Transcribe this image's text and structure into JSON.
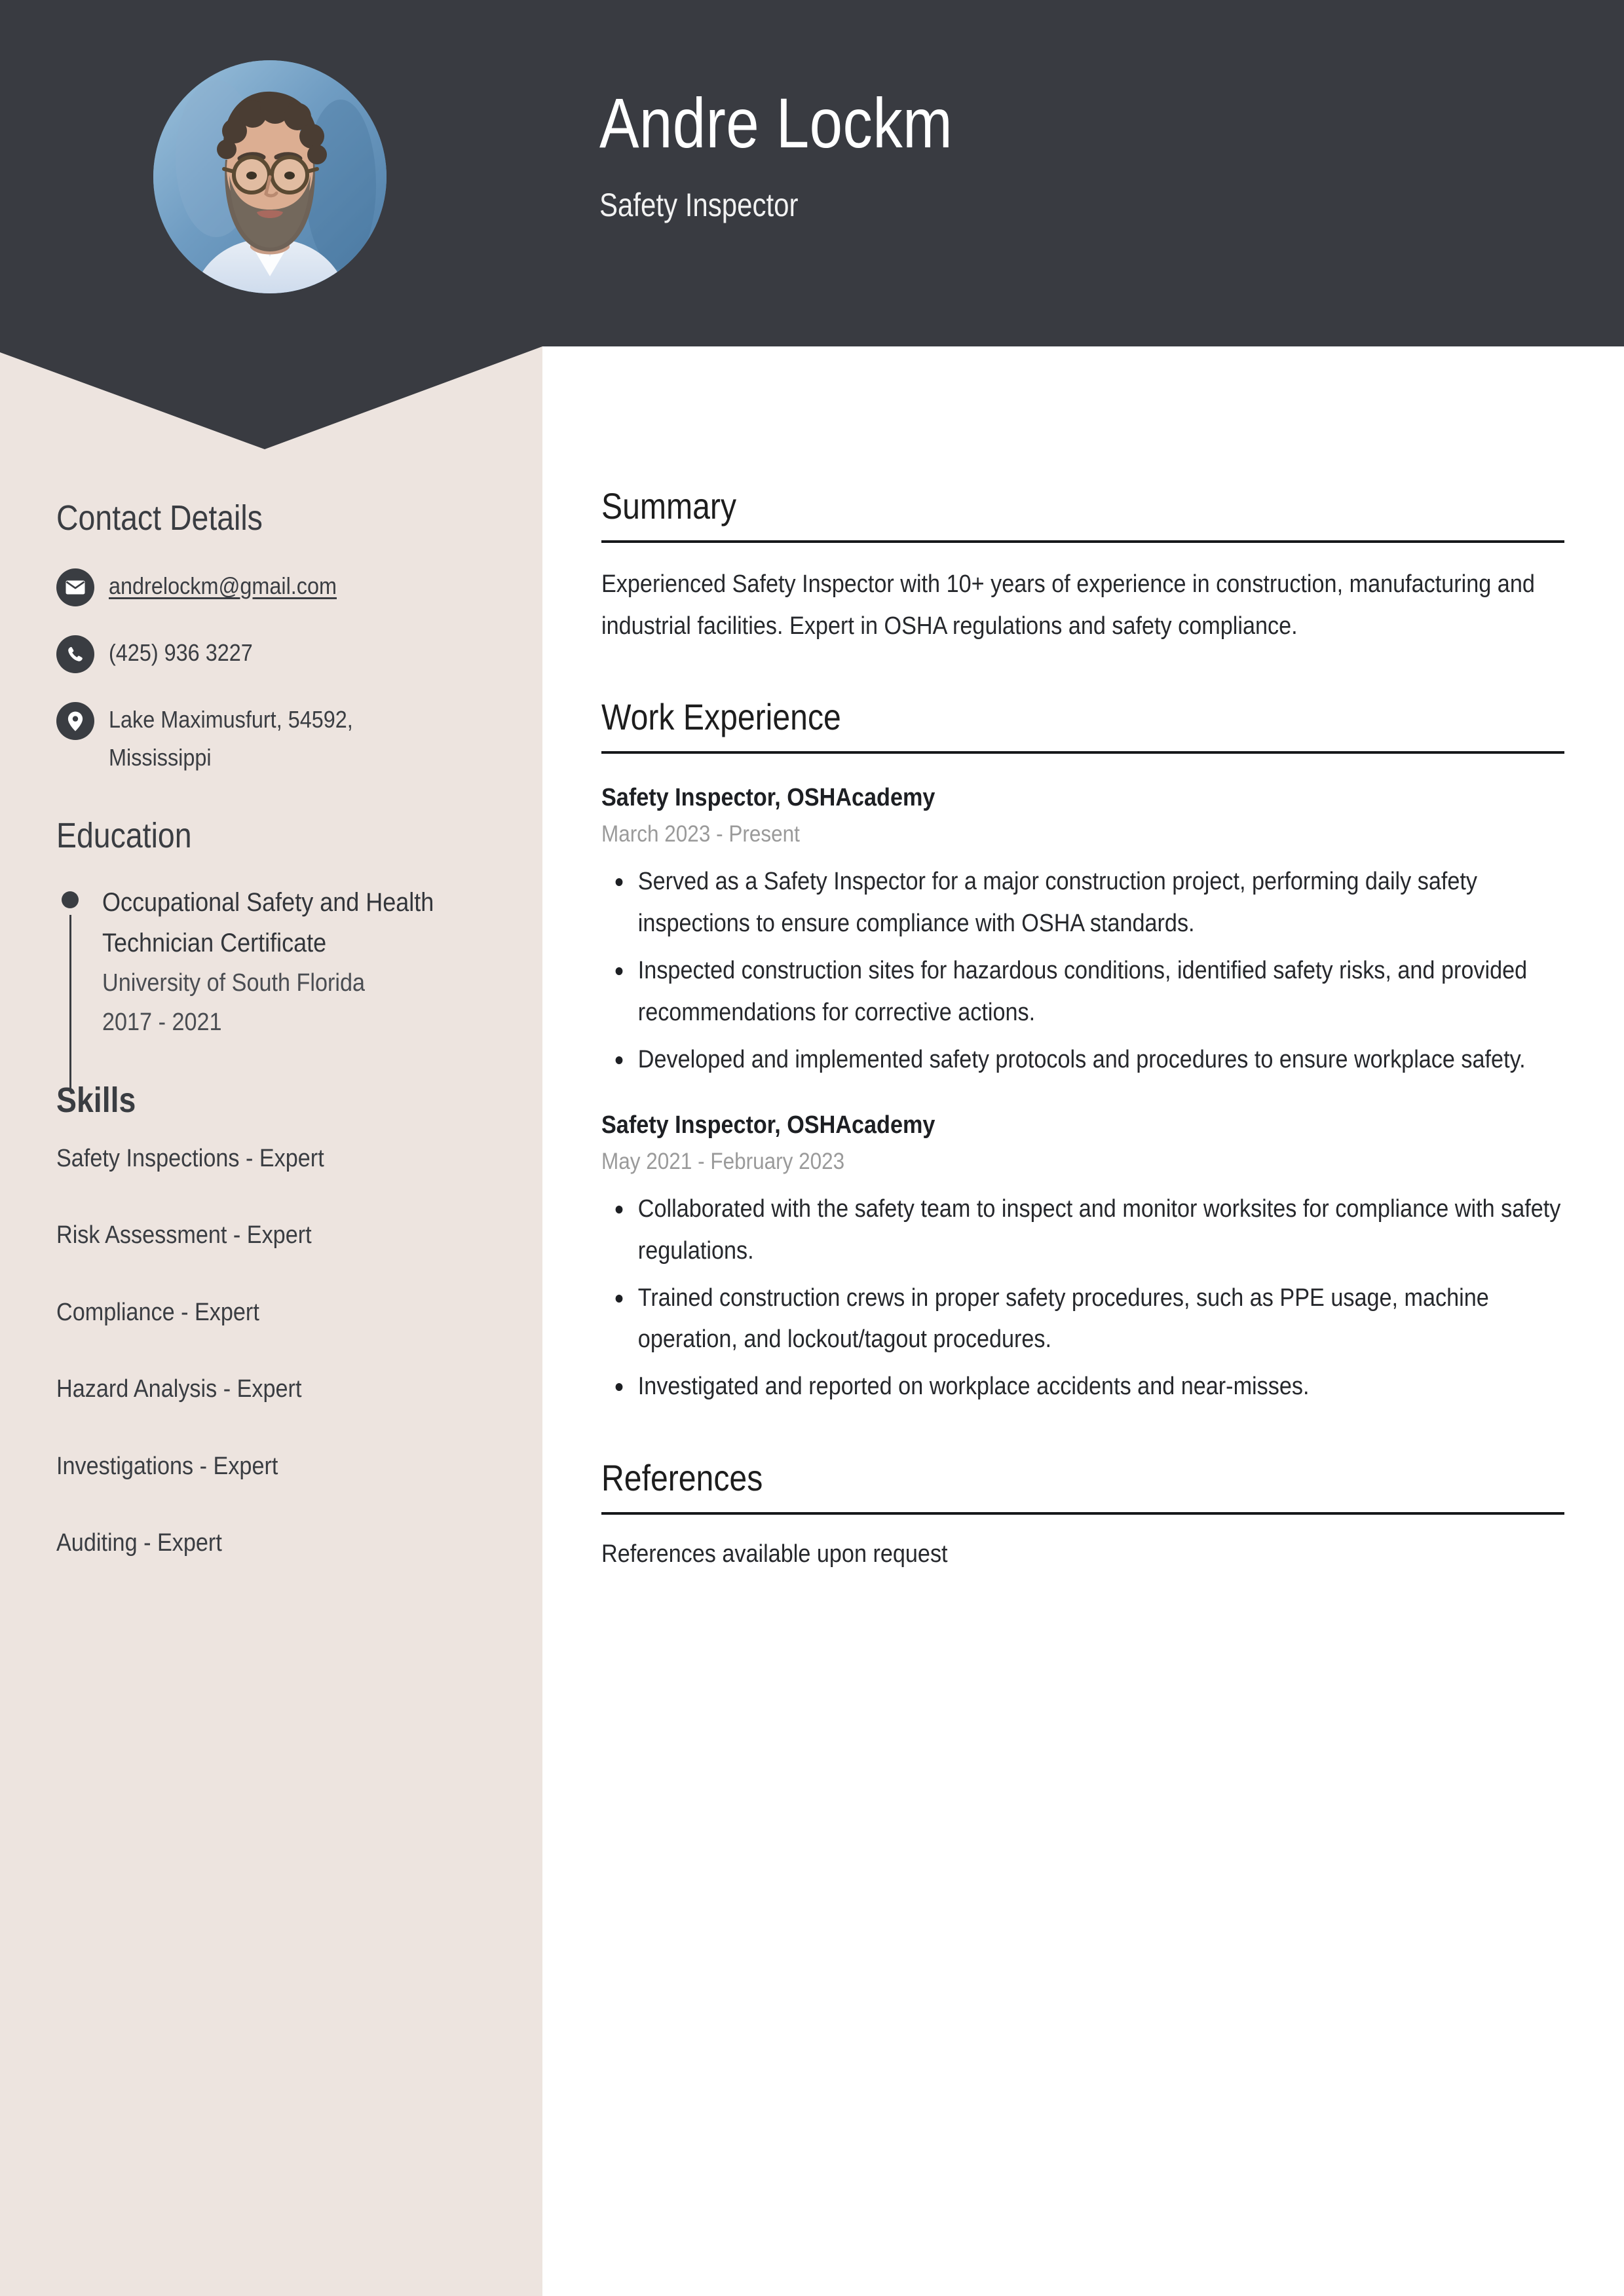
{
  "header": {
    "name": "Andre Lockm",
    "job_title": "Safety Inspector",
    "avatar_alt": "portrait-photo"
  },
  "sidebar": {
    "contact": {
      "heading": "Contact Details",
      "items": [
        {
          "icon": "envelope-icon",
          "value": "andrelockm@gmail.com",
          "is_link": true
        },
        {
          "icon": "phone-icon",
          "value": "(425) 936 3227",
          "is_link": false
        },
        {
          "icon": "location-pin-icon",
          "value": "Lake Maximusfurt, 54592, Mississippi",
          "is_link": false
        }
      ]
    },
    "education": {
      "heading": "Education",
      "items": [
        {
          "degree": "Occupational Safety and Health Technician Certificate",
          "school": "University of South Florida",
          "dates": "2017 - 2021"
        }
      ]
    },
    "skills": {
      "heading": "Skills",
      "items": [
        "Safety Inspections - Expert",
        "Risk Assessment - Expert",
        "Compliance - Expert",
        "Hazard Analysis - Expert",
        "Investigations - Expert",
        "Auditing - Expert"
      ]
    }
  },
  "main": {
    "summary": {
      "heading": "Summary",
      "text": "Experienced Safety Inspector with 10+ years of experience in construction, manufacturing and industrial facilities. Expert in OSHA regulations and safety compliance."
    },
    "work_experience": {
      "heading": "Work Experience",
      "jobs": [
        {
          "title": "Safety Inspector, OSHAcademy",
          "dates": "March 2023 - Present",
          "bullets": [
            "Served as a Safety Inspector for a major construction project, performing daily safety inspections to ensure compliance with OSHA standards.",
            "Inspected construction sites for hazardous conditions, identified safety risks, and provided recommendations for corrective actions.",
            "Developed and implemented safety protocols and procedures to ensure workplace safety."
          ]
        },
        {
          "title": "Safety Inspector, OSHAcademy",
          "dates": "May 2021 - February 2023",
          "bullets": [
            "Collaborated with the safety team to inspect and monitor worksites for compliance with safety regulations.",
            "Trained construction crews in proper safety procedures, such as PPE usage, machine operation, and lockout/tagout procedures.",
            "Investigated and reported on workplace accidents and near-misses."
          ]
        }
      ]
    },
    "references": {
      "heading": "References",
      "text": "References available upon request"
    }
  },
  "colors": {
    "header_dark": "#393B41",
    "sidebar_beige": "#EDE4DF",
    "page_white": "#FFFFFF",
    "text_dark": "#26282C",
    "date_gray": "#9A9A9A"
  }
}
